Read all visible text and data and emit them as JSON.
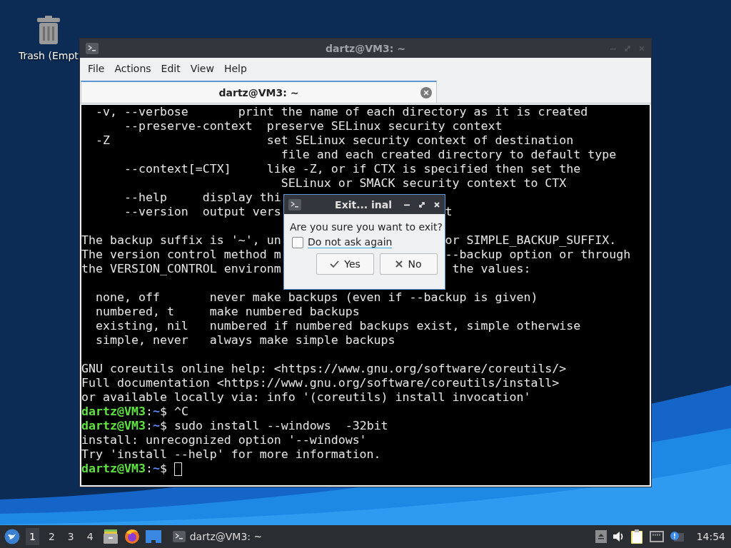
{
  "desktop": {
    "icons": [
      {
        "label": "Trash (Empt"
      }
    ]
  },
  "terminal_window": {
    "title": "dartz@VM3: ~",
    "menu": [
      "File",
      "Actions",
      "Edit",
      "View",
      "Help"
    ],
    "tabs": [
      {
        "label": "dartz@VM3: ~",
        "selected": true
      }
    ],
    "lines": [
      {
        "kind": "text",
        "segments": [
          "  -v, --verbose       print the name of each directory as it is created"
        ]
      },
      {
        "kind": "text",
        "segments": [
          "      --preserve-context  preserve SELinux security context"
        ]
      },
      {
        "kind": "text",
        "segments": [
          "  -Z                      set SELinux security context of destination"
        ]
      },
      {
        "kind": "text",
        "segments": [
          "                            file and each created directory to default type"
        ]
      },
      {
        "kind": "text",
        "segments": [
          "      --context[=CTX]     like -Z, or if CTX is specified then set the"
        ]
      },
      {
        "kind": "text",
        "segments": [
          "                            SELinux or SMACK security context to CTX"
        ]
      },
      {
        "kind": "text",
        "segments": [
          "      --help     display thi"
        ]
      },
      {
        "kind": "text",
        "segments": [
          "      --version  output vers",
          "t"
        ]
      },
      {
        "kind": "blank"
      },
      {
        "kind": "text",
        "segments": [
          "The backup suffix is '~', un",
          "or SIMPLE_BACKUP_SUFFIX."
        ]
      },
      {
        "kind": "text",
        "segments": [
          "The version control method m",
          "--backup option or through"
        ]
      },
      {
        "kind": "text",
        "segments": [
          "the VERSION_CONTROL environm",
          " the values:"
        ]
      },
      {
        "kind": "blank"
      },
      {
        "kind": "text",
        "segments": [
          "  none, off       never make backups (even if --backup is given)"
        ]
      },
      {
        "kind": "text",
        "segments": [
          "  numbered, t     make numbered backups"
        ]
      },
      {
        "kind": "text",
        "segments": [
          "  existing, nil   numbered if numbered backups exist, simple otherwise"
        ]
      },
      {
        "kind": "text",
        "segments": [
          "  simple, never   always make simple backups"
        ]
      },
      {
        "kind": "blank"
      },
      {
        "kind": "text",
        "segments": [
          "GNU coreutils online help: <https://www.gnu.org/software/coreutils/>"
        ]
      },
      {
        "kind": "text",
        "segments": [
          "Full documentation <https://www.gnu.org/software/coreutils/install>"
        ]
      },
      {
        "kind": "text",
        "segments": [
          "or available locally via: info '(coreutils) install invocation'"
        ]
      },
      {
        "kind": "prompt",
        "user": "dartz@VM3",
        "sep": ":",
        "path": "~",
        "symbol": "$",
        "command": "^C"
      },
      {
        "kind": "prompt",
        "user": "dartz@VM3",
        "sep": ":",
        "path": "~",
        "symbol": "$",
        "command": "sudo install --windows  -32bit"
      },
      {
        "kind": "text",
        "segments": [
          "install: unrecognized option '--windows'"
        ]
      },
      {
        "kind": "text",
        "segments": [
          "Try 'install --help' for more information."
        ]
      },
      {
        "kind": "prompt",
        "user": "dartz@VM3",
        "sep": ":",
        "path": "~",
        "symbol": "$",
        "cursor": true
      }
    ]
  },
  "dialog": {
    "title": "Exit... inal",
    "message": "Are you sure you want to exit?",
    "checkbox": {
      "label": "Do not ask again",
      "checked": false
    },
    "buttons": [
      {
        "label": "Yes",
        "kind": "yes"
      },
      {
        "label": "No",
        "kind": "no"
      }
    ]
  },
  "taskbar": {
    "workspaces": [
      {
        "label": "1",
        "selected": true
      },
      {
        "label": "2",
        "selected": false
      },
      {
        "label": "3",
        "selected": false
      },
      {
        "label": "4",
        "selected": false
      }
    ],
    "tasks": [
      {
        "label": "dartz@VM3: ~"
      }
    ],
    "clock": "14:54"
  }
}
